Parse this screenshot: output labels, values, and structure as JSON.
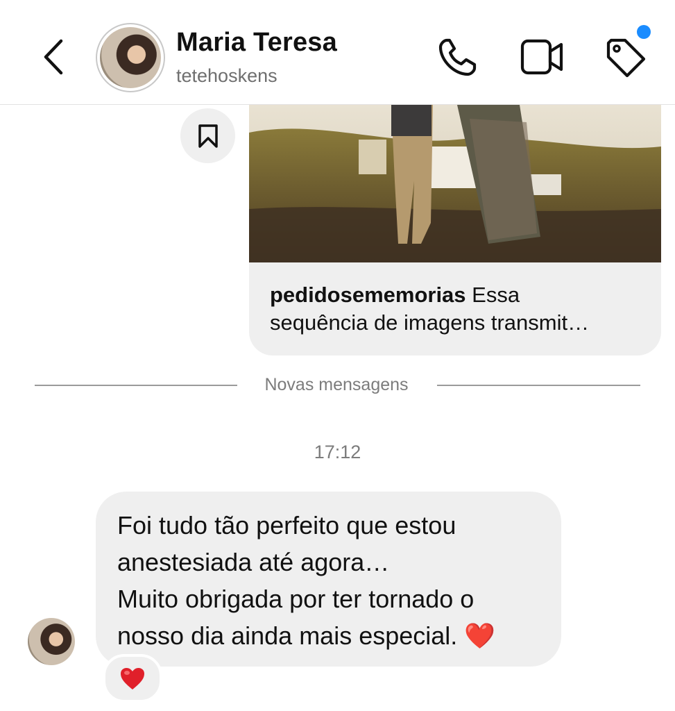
{
  "header": {
    "contact_name": "Maria Teresa",
    "username": "tetehoskens",
    "icons": [
      "back-icon",
      "phone-icon",
      "video-icon",
      "tag-icon"
    ],
    "notification_dot_color": "#1a8cff"
  },
  "shared_post": {
    "author": "pedidosememorias",
    "caption_lines": [
      "Essa",
      "sequência de imagens transmit…"
    ],
    "save_icon": "bookmark-icon"
  },
  "divider": {
    "label": "Novas mensagens"
  },
  "timestamp": "17:12",
  "message": {
    "lines": [
      "Foi tudo tão perfeito que estou",
      "anestesiada até agora…",
      "Muito obrigada por ter tornado o",
      "nosso dia ainda mais especial. ❤️"
    ],
    "reaction": "❤️"
  },
  "colors": {
    "bubble": "#efefef",
    "accent": "#1a8cff",
    "heart": "#e0202a"
  }
}
